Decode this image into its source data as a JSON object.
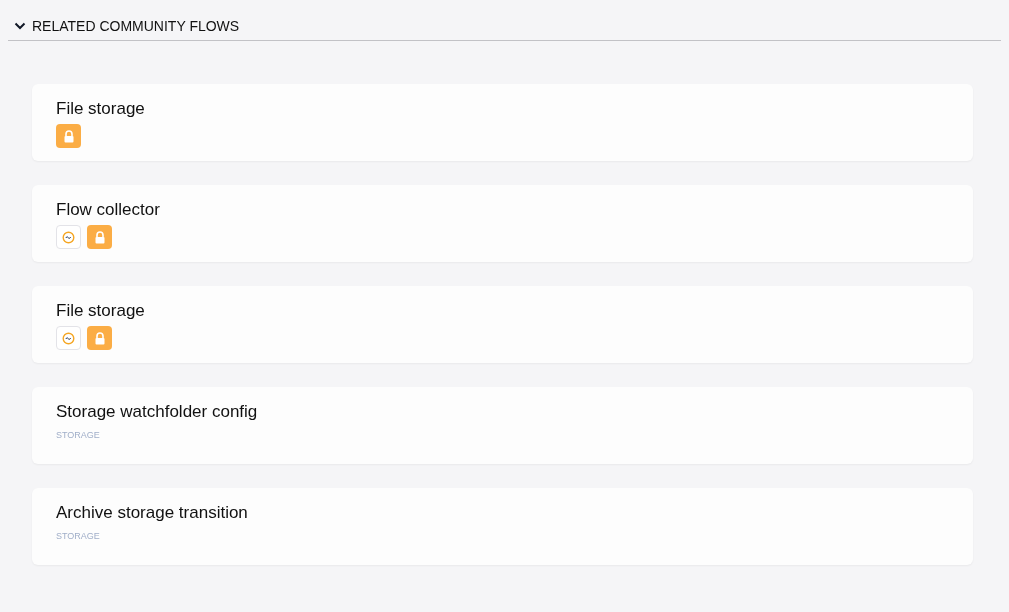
{
  "section": {
    "title": "RELATED COMMUNITY FLOWS",
    "expanded": true
  },
  "flows": [
    {
      "title": "File storage",
      "badges": [
        {
          "kind": "lock"
        }
      ]
    },
    {
      "title": "Flow collector",
      "badges": [
        {
          "kind": "flow"
        },
        {
          "kind": "lock"
        }
      ]
    },
    {
      "title": "File storage",
      "badges": [
        {
          "kind": "flow"
        },
        {
          "kind": "lock"
        }
      ]
    },
    {
      "title": "Storage watchfolder config",
      "tag": "STORAGE"
    },
    {
      "title": "Archive storage transition",
      "tag": "STORAGE"
    }
  ]
}
